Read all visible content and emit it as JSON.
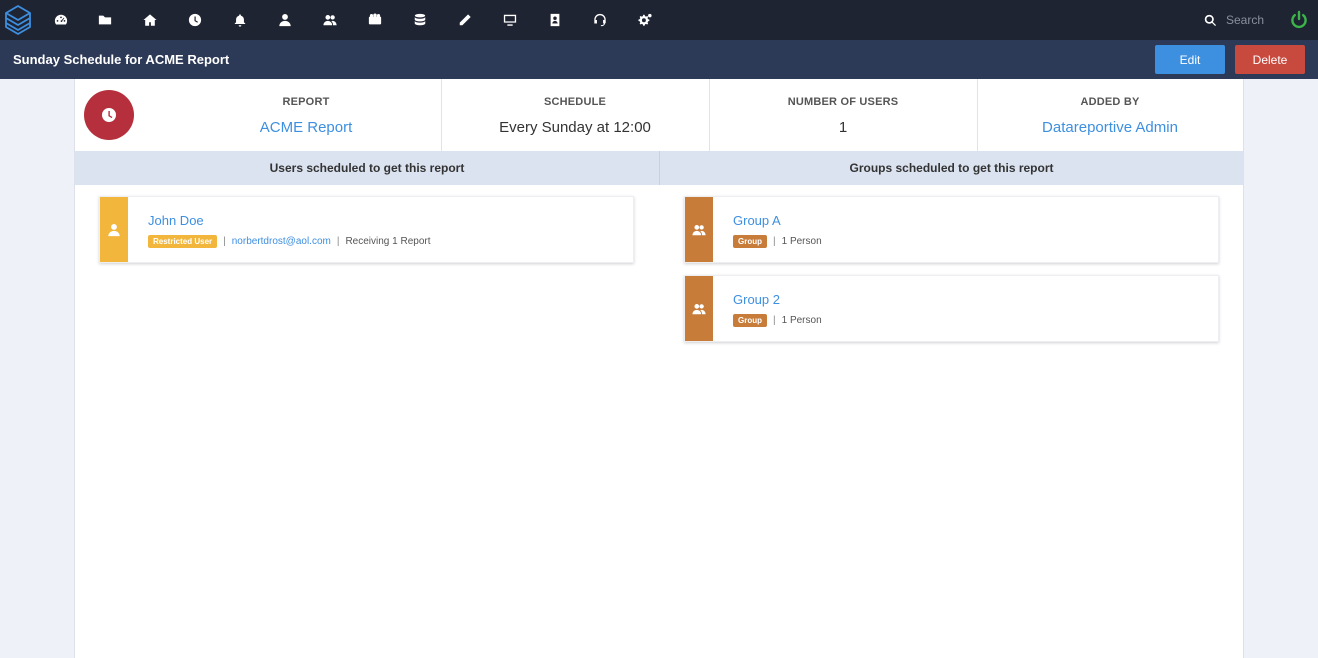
{
  "topnav": {
    "icons": [
      "dashboard-icon",
      "folder-icon",
      "home-icon",
      "clock-icon",
      "bell-icon",
      "user-icon",
      "users-icon",
      "team-icon",
      "database-icon",
      "pencil-icon",
      "monitor-icon",
      "address-book-icon",
      "headset-icon",
      "cogs-icon"
    ],
    "search_placeholder": "Search",
    "power_color": "#3bb54a"
  },
  "header": {
    "title": "Sunday Schedule for ACME Report",
    "edit_label": "Edit",
    "delete_label": "Delete"
  },
  "summary": {
    "report_label": "REPORT",
    "report_value": "ACME Report",
    "schedule_label": "SCHEDULE",
    "schedule_value": "Every Sunday at 12:00",
    "users_label": "NUMBER OF USERS",
    "users_value": "1",
    "added_label": "ADDED BY",
    "added_value": "Datareportive Admin"
  },
  "users_section": {
    "heading": "Users scheduled to get this report",
    "items": [
      {
        "name": "John Doe",
        "badge": "Restricted User",
        "email": "norbertdrost@aol.com",
        "info": "Receiving 1 Report"
      }
    ]
  },
  "groups_section": {
    "heading": "Groups scheduled to get this report",
    "items": [
      {
        "name": "Group A",
        "badge": "Group",
        "info": "1 Person"
      },
      {
        "name": "Group 2",
        "badge": "Group",
        "info": "1 Person"
      }
    ]
  },
  "colors": {
    "nav_bg": "#1f2433",
    "header_bg": "#2c3a57",
    "accent_blue": "#3d8fe0",
    "danger": "#c84a3f",
    "clock_badge": "#b5303c",
    "user_strip": "#f2b63c",
    "group_strip": "#c77c3a"
  }
}
